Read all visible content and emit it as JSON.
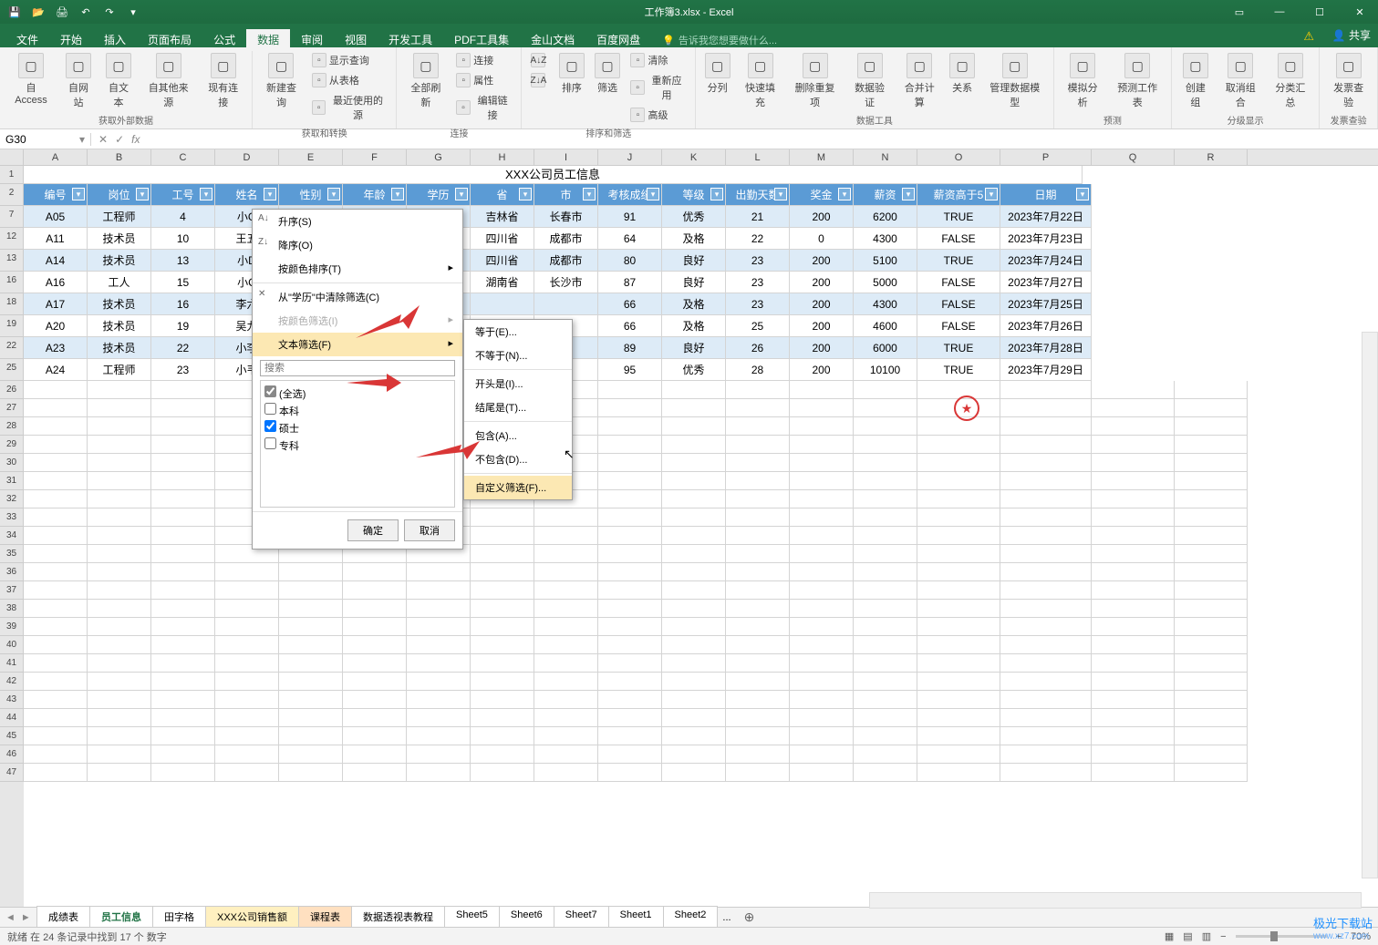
{
  "titlebar": {
    "title": "工作簿3.xlsx - Excel",
    "share": "共享"
  },
  "menu": {
    "tabs": [
      "文件",
      "开始",
      "插入",
      "页面布局",
      "公式",
      "数据",
      "审阅",
      "视图",
      "开发工具",
      "PDF工具集",
      "金山文档",
      "百度网盘"
    ],
    "active_index": 5,
    "tell_me": "告诉我您想要做什么..."
  },
  "ribbon": {
    "groups": [
      {
        "label": "获取外部数据",
        "btns": [
          "自 Access",
          "自网站",
          "自文本",
          "自其他来源",
          "现有连接"
        ]
      },
      {
        "label": "获取和转换",
        "btns": [
          "新建查询"
        ],
        "small": [
          "显示查询",
          "从表格",
          "最近使用的源"
        ]
      },
      {
        "label": "连接",
        "btns": [
          "全部刷新"
        ],
        "small": [
          "连接",
          "属性",
          "编辑链接"
        ]
      },
      {
        "label": "排序和筛选",
        "btns": [
          "排序",
          "筛选"
        ],
        "small": [
          "清除",
          "重新应用",
          "高级"
        ],
        "az": [
          "A↓Z",
          "Z↓A"
        ]
      },
      {
        "label": "数据工具",
        "btns": [
          "分列",
          "快速填充",
          "删除重复项",
          "数据验证",
          "合并计算",
          "关系",
          "管理数据模型"
        ]
      },
      {
        "label": "预测",
        "btns": [
          "模拟分析",
          "预测工作表"
        ]
      },
      {
        "label": "分级显示",
        "btns": [
          "创建组",
          "取消组合",
          "分类汇总"
        ]
      },
      {
        "label": "发票查验",
        "btns": [
          "发票查验"
        ]
      }
    ]
  },
  "namebox": "G30",
  "columns": [
    "A",
    "B",
    "C",
    "D",
    "E",
    "F",
    "G",
    "H",
    "I",
    "J",
    "K",
    "L",
    "M",
    "N",
    "O",
    "P",
    "Q",
    "R"
  ],
  "visible_row_nums": [
    "1",
    "2",
    "7",
    "12",
    "13",
    "16",
    "18",
    "19",
    "22",
    "25",
    "26",
    "27",
    "28",
    "29",
    "30",
    "31",
    "32",
    "33",
    "34",
    "35",
    "36",
    "37",
    "38",
    "39",
    "40",
    "41",
    "42",
    "43",
    "44",
    "45",
    "46",
    "47"
  ],
  "table": {
    "title": "XXX公司员工信息",
    "headers": [
      "编号",
      "岗位",
      "工号",
      "姓名",
      "性别",
      "年龄",
      "学历",
      "省",
      "市",
      "考核成绩",
      "等级",
      "出勤天数",
      "奖金",
      "薪资",
      "薪资高于5",
      "日期"
    ],
    "rows": [
      [
        "A05",
        "工程师",
        "4",
        "小G",
        "",
        "",
        "",
        "吉林省",
        "长春市",
        "91",
        "优秀",
        "21",
        "200",
        "6200",
        "TRUE",
        "2023年7月22日"
      ],
      [
        "A11",
        "技术员",
        "10",
        "王五",
        "",
        "",
        "",
        "四川省",
        "成都市",
        "64",
        "及格",
        "22",
        "0",
        "4300",
        "FALSE",
        "2023年7月23日"
      ],
      [
        "A14",
        "技术员",
        "13",
        "小D",
        "",
        "",
        "",
        "四川省",
        "成都市",
        "80",
        "良好",
        "23",
        "200",
        "5100",
        "TRUE",
        "2023年7月24日"
      ],
      [
        "A16",
        "工人",
        "15",
        "小C",
        "",
        "",
        "",
        "湖南省",
        "长沙市",
        "87",
        "良好",
        "23",
        "200",
        "5000",
        "FALSE",
        "2023年7月27日"
      ],
      [
        "A17",
        "技术员",
        "16",
        "李六",
        "",
        "",
        "",
        "",
        "",
        "66",
        "及格",
        "23",
        "200",
        "4300",
        "FALSE",
        "2023年7月25日"
      ],
      [
        "A20",
        "技术员",
        "19",
        "吴九",
        "",
        "",
        "",
        "",
        "",
        "66",
        "及格",
        "25",
        "200",
        "4600",
        "FALSE",
        "2023年7月26日"
      ],
      [
        "A23",
        "技术员",
        "22",
        "小李",
        "",
        "",
        "",
        "",
        "",
        "89",
        "良好",
        "26",
        "200",
        "6000",
        "TRUE",
        "2023年7月28日"
      ],
      [
        "A24",
        "工程师",
        "23",
        "小韦",
        "",
        "",
        "",
        "",
        "",
        "95",
        "优秀",
        "28",
        "200",
        "10100",
        "TRUE",
        "2023年7月29日"
      ]
    ]
  },
  "filter": {
    "sort_asc": "升序(S)",
    "sort_desc": "降序(O)",
    "sort_color": "按颜色排序(T)",
    "clear": "从\"学历\"中清除筛选(C)",
    "filter_color": "按颜色筛选(I)",
    "text_filter": "文本筛选(F)",
    "search_ph": "搜索",
    "opts": [
      {
        "label": "(全选)",
        "checked": true,
        "mixed": true
      },
      {
        "label": "本科",
        "checked": false
      },
      {
        "label": "硕士",
        "checked": true
      },
      {
        "label": "专科",
        "checked": false
      }
    ],
    "ok": "确定",
    "cancel": "取消"
  },
  "submenu": {
    "items": [
      "等于(E)...",
      "不等于(N)...",
      "开头是(I)...",
      "结尾是(T)...",
      "包含(A)...",
      "不包含(D)...",
      "自定义筛选(F)..."
    ]
  },
  "sheets": {
    "nav": [
      "◄",
      "►"
    ],
    "tabs": [
      {
        "name": "成绩表",
        "cls": ""
      },
      {
        "name": "员工信息",
        "cls": "active"
      },
      {
        "name": "田字格",
        "cls": ""
      },
      {
        "name": "XXX公司销售额",
        "cls": "mark1"
      },
      {
        "name": "课程表",
        "cls": "mark2"
      },
      {
        "name": "数据透视表教程",
        "cls": ""
      },
      {
        "name": "Sheet5",
        "cls": ""
      },
      {
        "name": "Sheet6",
        "cls": ""
      },
      {
        "name": "Sheet7",
        "cls": ""
      },
      {
        "name": "Sheet1",
        "cls": ""
      },
      {
        "name": "Sheet2",
        "cls": ""
      }
    ],
    "add": "⊕",
    "more": "..."
  },
  "status": {
    "left": "就绪    在 24 条记录中找到 17 个    数字",
    "zoom": "70%"
  },
  "watermark": {
    "main": "极光下载站",
    "sub": "www.xz7.com"
  }
}
